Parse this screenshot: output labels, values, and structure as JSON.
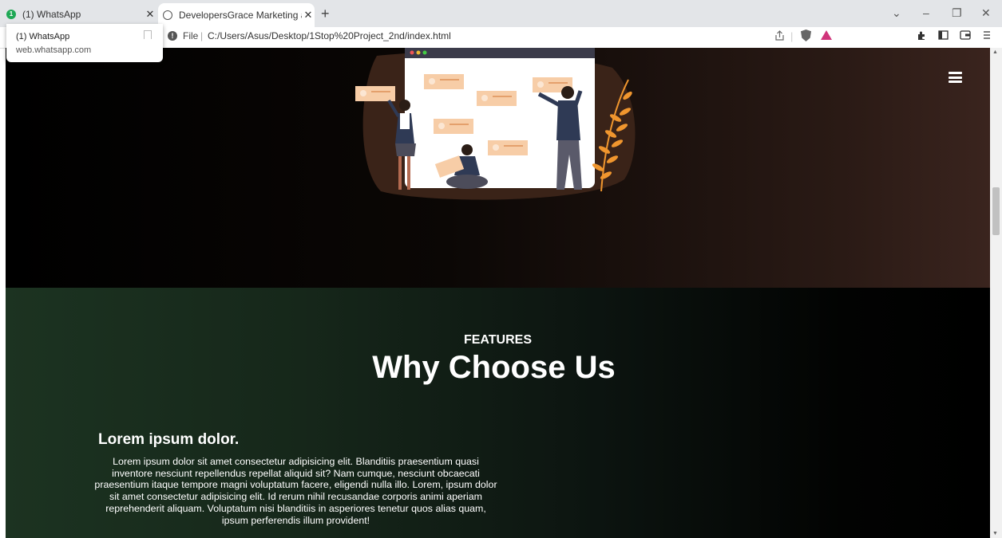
{
  "browser": {
    "tabs": [
      {
        "title": "(1) WhatsApp",
        "badge": "1",
        "active": false
      },
      {
        "title": "DevelopersGrace Marketing and …",
        "active": true
      }
    ],
    "new_tab_label": "+",
    "close_glyph": "✕",
    "address": {
      "scheme": "File",
      "separator": "|",
      "url": "C:/Users/Asus/Desktop/1Stop%20Project_2nd/index.html"
    },
    "tooltip": {
      "title": "(1) WhatsApp",
      "subtitle": "web.whatsapp.com"
    },
    "icons": [
      "share-icon",
      "brave-shield-icon",
      "brave-rewards-icon",
      "extensions-icon",
      "sidebar-icon",
      "wallet-icon",
      "menu-icon"
    ],
    "window_controls": {
      "list": "⌄",
      "minimize": "–",
      "maximize": "❐",
      "close": "✕"
    }
  },
  "hero": {
    "illustration": "team-board-illustration"
  },
  "features": {
    "kicker": "FEATURES",
    "title": "Why Choose Us",
    "card": {
      "title": "Lorem ipsum dolor.",
      "body": "Lorem ipsum dolor sit amet consectetur adipisicing elit. Blanditiis praesentium quasi inventore nesciunt repellendus repellat aliquid sit? Nam cumque, nesciunt obcaecati praesentium itaque tempore magni voluptatum facere, eligendi nulla illo. Lorem, ipsum dolor sit amet consectetur adipisicing elit. Id rerum nihil recusandae corporis animi aperiam reprehenderit aliquam. Voluptatum nisi blanditiis in asperiores tenetur quos alias quam, ipsum perferendis illum provident!"
    }
  },
  "colors": {
    "tabstrip": "#e3e5e8",
    "hero_dark": "#000000",
    "hero_warm": "#3a241e",
    "features_green": "#1c3321",
    "illustration_peach": "#f7cda7",
    "illustration_orange": "#f0962e"
  }
}
